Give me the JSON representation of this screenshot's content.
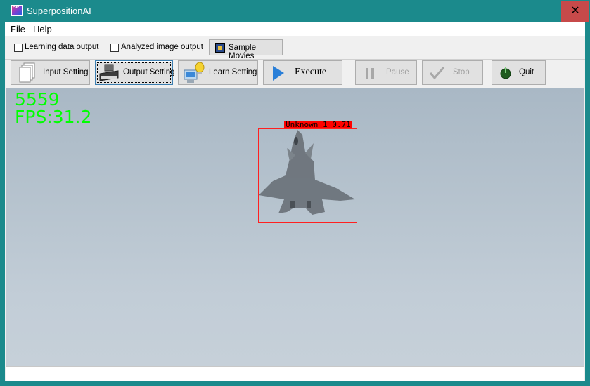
{
  "window": {
    "title": "SuperpositionAI",
    "icon_text": "SP",
    "close_glyph": "✕"
  },
  "menu": {
    "file": "File",
    "help": "Help"
  },
  "options": {
    "learning_data_output": {
      "label": "Learning data output",
      "checked": false
    },
    "analyzed_image_output": {
      "label": "Analyzed image output",
      "checked": false
    },
    "sample_movies": "Sample Movies"
  },
  "toolbar": {
    "input_setting": "Input Setting",
    "output_setting": "Output Setting",
    "learn_setting": "Learn Setting",
    "execute": "Execute",
    "pause": "Pause",
    "stop": "Stop",
    "quit": "Quit"
  },
  "video": {
    "frame_count": "5559",
    "fps": "FPS:31.2",
    "detection_label": "Unknown 1 0.71"
  },
  "colors": {
    "title_bar": "#1b8a8c",
    "close_button": "#c74a4a",
    "overlay_text": "#00ff00",
    "bbox": "#ff2020"
  }
}
